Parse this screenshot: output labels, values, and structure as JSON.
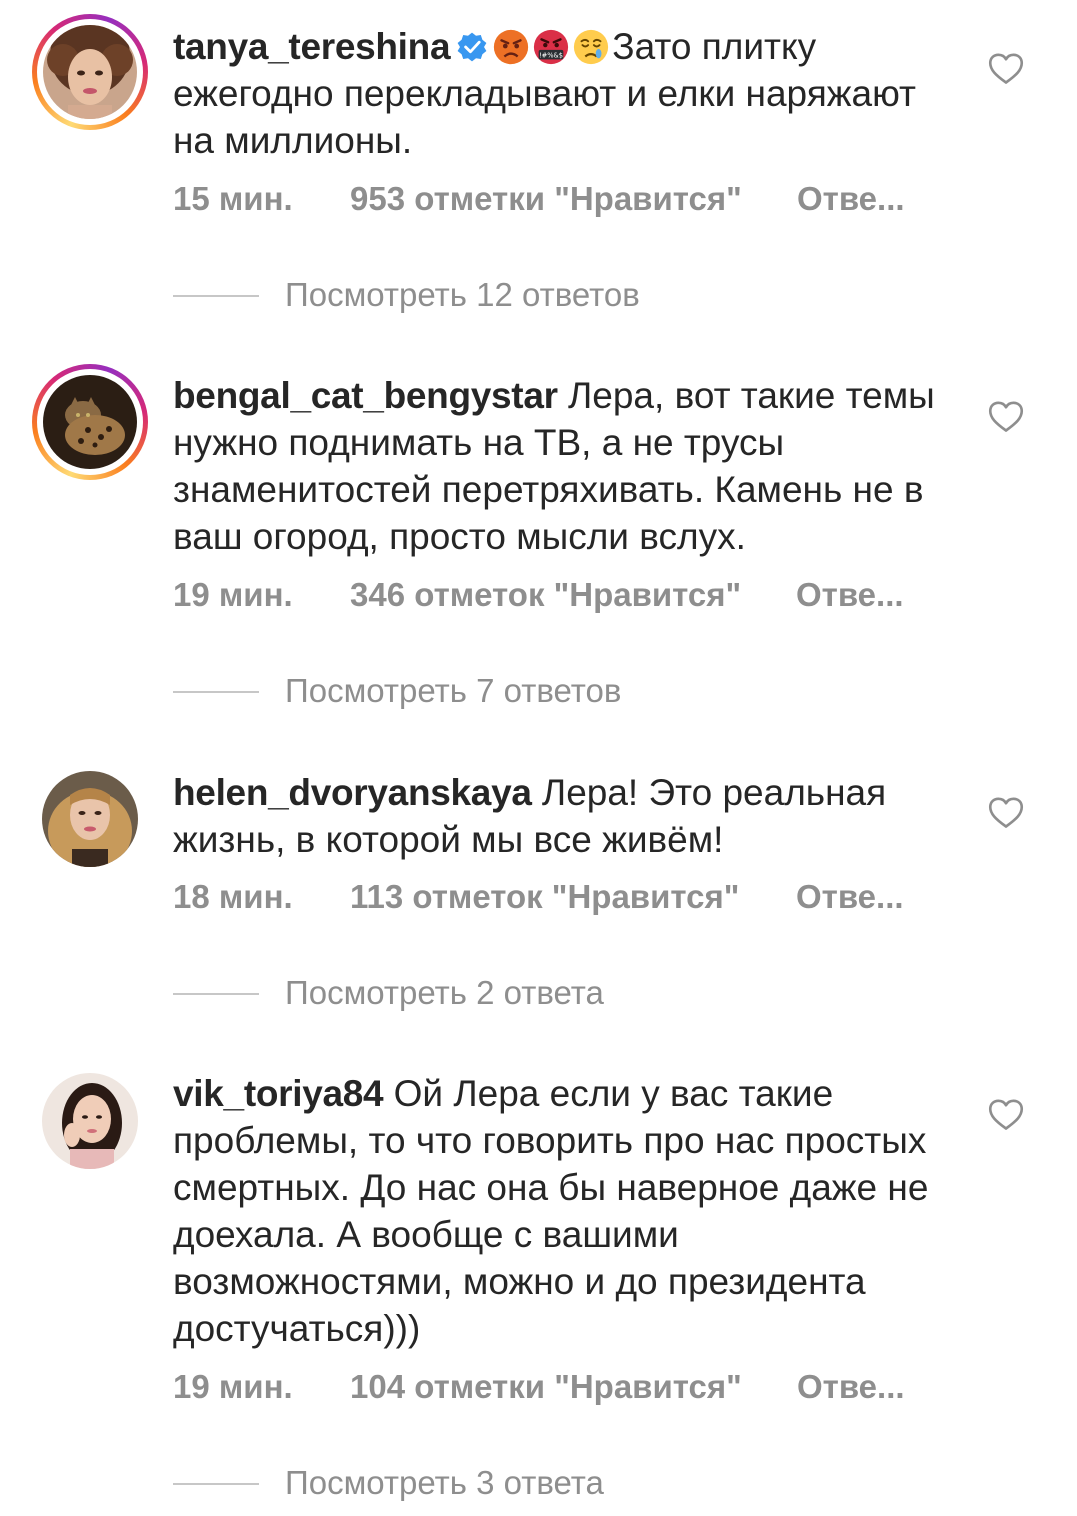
{
  "comments": [
    {
      "username": "tanya_tereshina",
      "verified": true,
      "emojis": [
        "angry-face",
        "face-with-symbols",
        "crying-face"
      ],
      "text": "Зато плитку ежегодно перекладывают и елки наряжают на миллионы.",
      "time": "15 мин.",
      "likes": "953 отметки \"Нравится\"",
      "reply": "Отве...",
      "view_replies": "Посмотреть 12 ответов",
      "story_ring": true
    },
    {
      "username": "bengal_cat_bengystar",
      "verified": false,
      "text": "Лера, вот такие темы нужно поднимать на ТВ, а не трусы знаменитостей перетряхивать. Камень не в ваш огород, просто мысли вслух.",
      "time": "19 мин.",
      "likes": "346 отметок \"Нравится\"",
      "reply": "Отве...",
      "view_replies": "Посмотреть 7 ответов",
      "story_ring": true
    },
    {
      "username": "helen_dvoryanskaya",
      "verified": false,
      "text": "Лера! Это реальная жизнь, в которой мы все живём!",
      "time": "18 мин.",
      "likes": "113 отметок \"Нравится\"",
      "reply": "Отве...",
      "view_replies": "Посмотреть 2 ответа",
      "story_ring": false
    },
    {
      "username": "vik_toriya84",
      "verified": false,
      "text": "Ой Лера если у вас такие проблемы, то что говорить про нас простых смертных. До нас она бы наверное даже не доехала. А вообще с вашими возможностями, можно и до президента достучаться)))",
      "time": "19 мин.",
      "likes": "104 отметки \"Нравится\"",
      "reply": "Отве...",
      "view_replies": "Посмотреть 3 ответа",
      "story_ring": false
    }
  ],
  "icons": {
    "like": "heart-outline-icon",
    "verified": "verified-badge-icon"
  },
  "colors": {
    "text": "#262626",
    "secondary": "#8e8e8e",
    "verified": "#3897f0",
    "divider": "#c7c7c7"
  }
}
